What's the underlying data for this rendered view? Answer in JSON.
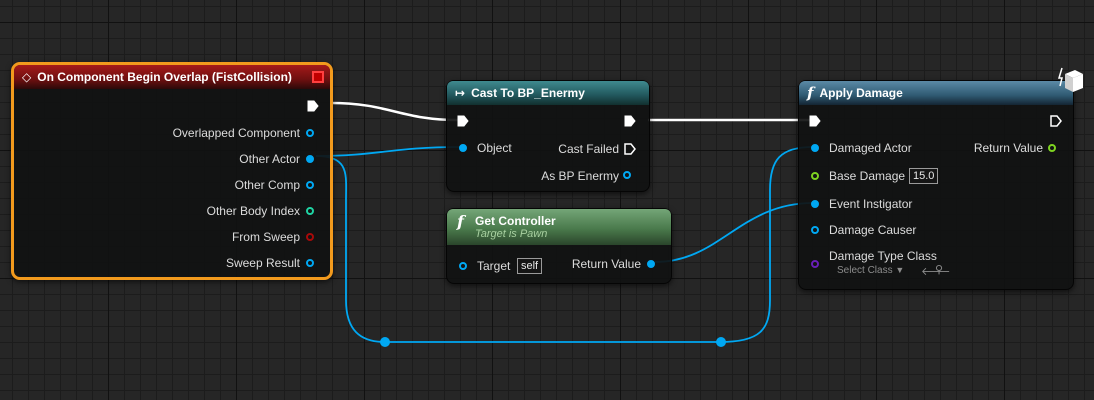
{
  "nodes": {
    "event": {
      "title": "On Component Begin Overlap (FistCollision)",
      "pins": {
        "overlapped_component": "Overlapped Component",
        "other_actor": "Other Actor",
        "other_comp": "Other Comp",
        "other_body_index": "Other Body Index",
        "from_sweep": "From Sweep",
        "sweep_result": "Sweep Result"
      }
    },
    "cast": {
      "title": "Cast To BP_Enermy",
      "pins": {
        "object": "Object",
        "cast_failed": "Cast Failed",
        "as_bp": "As BP Enermy"
      }
    },
    "get_controller": {
      "title": "Get Controller",
      "subtitle": "Target is Pawn",
      "pins": {
        "target": "Target",
        "target_value": "self",
        "return_value": "Return Value"
      }
    },
    "apply_damage": {
      "title": "Apply Damage",
      "pins": {
        "damaged_actor": "Damaged Actor",
        "return_value": "Return Value",
        "base_damage": "Base Damage",
        "base_damage_value": "15.0",
        "event_instigator": "Event Instigator",
        "damage_causer": "Damage Causer",
        "damage_type_class": "Damage Type Class",
        "select_class": "Select Class"
      }
    }
  },
  "colors": {
    "selection": "#f29a1d",
    "object_pin": "#00a8f3",
    "float_pin": "#7ed321",
    "int_pin": "#1fd4a4",
    "bool_pin": "#a80a0a",
    "class_pin": "#6a1fb8",
    "exec_wire": "#ffffff"
  },
  "icons": {
    "event": "event-diamond-icon",
    "cast": "cast-arrow-icon",
    "function": "function-f-icon",
    "close": "close-square-icon",
    "cube": "cube-icon",
    "dropdown": "chevron-down-icon",
    "use_selected": "use-selected-arrow-icon",
    "browse": "browse-magnifier-icon"
  }
}
